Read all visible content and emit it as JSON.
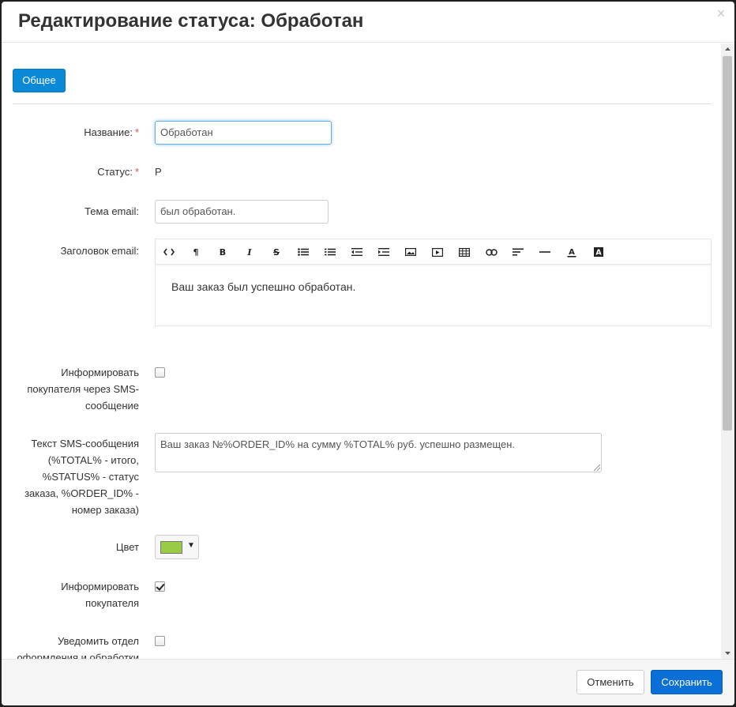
{
  "header": {
    "title": "Редактирование статуса: Обработан",
    "close_glyph": "×"
  },
  "tabs": [
    {
      "label": "Общее"
    }
  ],
  "form": {
    "name_label": "Название:",
    "name_value": "Обработан",
    "status_label": "Статус:",
    "status_value": "P",
    "required_mark": "*",
    "email_subject_label": "Тема email:",
    "email_subject_value": "был обработан.",
    "email_header_label": "Заголовок email:",
    "email_header_content": "Ваш заказ был успешно обработан.",
    "sms_notify_label": [
      "Информировать",
      "покупателя через SMS-",
      "сообщение"
    ],
    "sms_notify_checked": false,
    "sms_text_label": [
      "Текст SMS-сообщения",
      "(%TOTAL% - итого,",
      "%STATUS% - статус",
      "заказа, %ORDER_ID% -",
      "номер заказа)"
    ],
    "sms_text_value": "Ваш заказ №%ORDER_ID% на сумму %TOTAL% руб. успешно размещен.",
    "color_label": "Цвет",
    "color_value": "#99cc44",
    "notify_customer_label": [
      "Информировать",
      "покупателя"
    ],
    "notify_customer_checked": true,
    "notify_department_label": [
      "Уведомить отдел",
      "оформления и обработки"
    ],
    "notify_department_checked": false
  },
  "toolbar_icons": [
    "code-icon",
    "paragraph-icon",
    "bold-icon",
    "italic-icon",
    "strikethrough-icon",
    "unordered-list-icon",
    "ordered-list-icon",
    "outdent-icon",
    "indent-icon",
    "image-icon",
    "video-icon",
    "table-icon",
    "link-icon",
    "align-icon",
    "horizontal-rule-icon",
    "font-color-icon",
    "background-color-icon"
  ],
  "footer": {
    "cancel_label": "Отменить",
    "save_label": "Сохранить"
  },
  "colors": {
    "primary": "#0a89d6",
    "save": "#0a6fd6",
    "required": "#d9534f"
  }
}
